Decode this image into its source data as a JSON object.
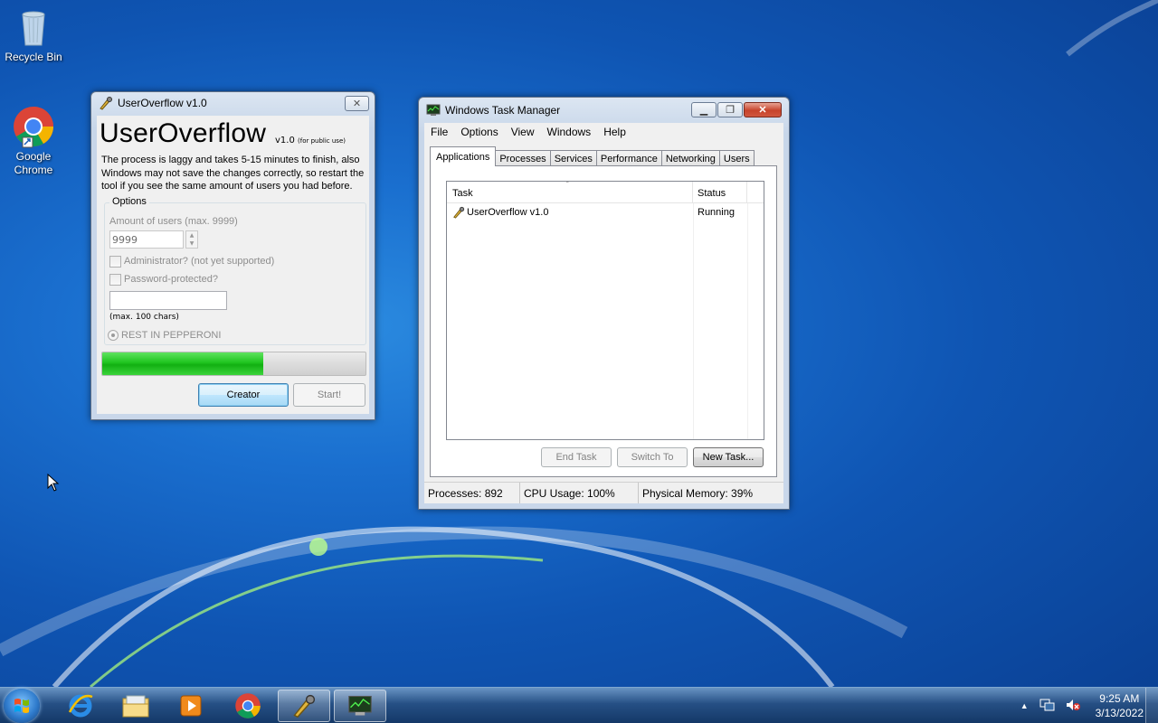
{
  "desktop": {
    "icons": [
      {
        "label": "Recycle Bin",
        "icon": "recycle-bin-icon"
      },
      {
        "label": "Google Chrome",
        "icon": "chrome-icon"
      }
    ]
  },
  "userOverflow": {
    "window_title": "UserOverflow v1.0",
    "app_name": "UserOverflow",
    "version": "v1.0",
    "public_note": "(for public use)",
    "description": "The process is laggy and takes 5-15 minutes to finish, also Windows may not save the changes correctly, so restart the tool if you see the same amount of users you had before.",
    "options_label": "Options",
    "amount_label": "Amount of users (max. 9999)",
    "amount_value": "9999",
    "admin_label": "Administrator? (not yet supported)",
    "password_label": "Password-protected?",
    "password_value": "",
    "max_chars_label": "(max. 100 chars)",
    "radio_label": "REST IN PEPPERONI",
    "progress": 0.61,
    "creator_button": "Creator",
    "start_button": "Start!"
  },
  "taskManager": {
    "window_title": "Windows Task Manager",
    "menu": [
      "File",
      "Options",
      "View",
      "Windows",
      "Help"
    ],
    "tabs": [
      "Applications",
      "Processes",
      "Services",
      "Performance",
      "Networking",
      "Users"
    ],
    "active_tab": "Applications",
    "columns": {
      "task": "Task",
      "status": "Status"
    },
    "rows": [
      {
        "task": "UserOverflow v1.0",
        "status": "Running"
      }
    ],
    "buttons": {
      "end_task": "End Task",
      "switch_to": "Switch To",
      "new_task": "New Task..."
    },
    "status": {
      "processes": "Processes: 892",
      "cpu": "CPU Usage: 100%",
      "memory": "Physical Memory: 39%"
    }
  },
  "taskbar": {
    "time": "9:25 AM",
    "date": "3/13/2022"
  },
  "colors": {
    "progress_fill": "#1fc41f",
    "desktop_blue": "#1a6fcf"
  }
}
